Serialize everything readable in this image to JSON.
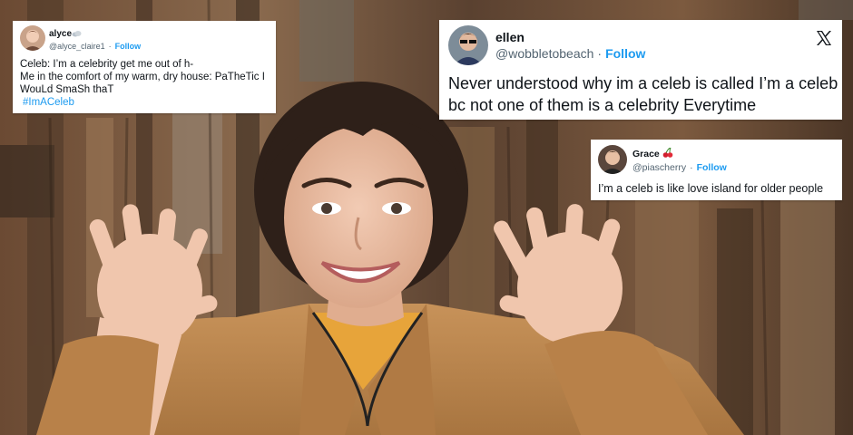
{
  "tweets": [
    {
      "display_name": "alyce",
      "handle": "@alyce_claire1",
      "follow_label": "Follow",
      "lines": [
        "Celeb: I’m a celebrity get me out of h-",
        "Me in the comfort of my warm, dry house: PaTheTic I",
        "WouLd SmaSh thaT"
      ],
      "hashtag": "#ImACeleb"
    },
    {
      "display_name": "ellen",
      "handle": "@wobbletobeach",
      "follow_label": "Follow",
      "lines": [
        "Never understood why im a celeb is called I’m a celeb",
        "bc not one of them is a celebrity Everytime"
      ]
    },
    {
      "display_name": "Grace",
      "handle": "@piascherry",
      "follow_label": "Follow",
      "lines": [
        "I’m a celeb is like love island for older people"
      ]
    }
  ],
  "colors": {
    "link_blue": "#1d9bf0",
    "handle_grey": "#536471",
    "jacket_tan": "#b8864e",
    "hair_dark": "#2e2019"
  },
  "icons": {
    "platform_logo": "x-logo-icon",
    "name_suffix_1": "cloud-emoji-icon",
    "name_suffix_3": "cherries-emoji-icon"
  }
}
